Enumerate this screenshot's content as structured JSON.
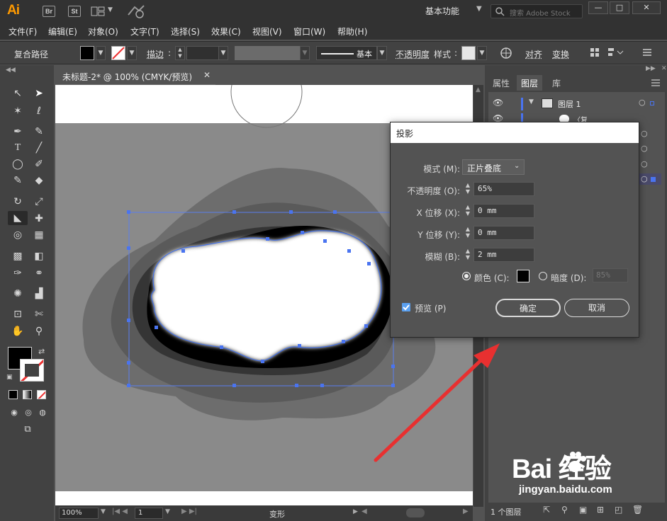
{
  "app": {
    "logo": "Ai",
    "badge_br": "Br",
    "badge_st": "St",
    "workspace": "基本功能",
    "stock_placeholder": "搜索 Adobe Stock"
  },
  "menu": [
    "文件(F)",
    "编辑(E)",
    "对象(O)",
    "文字(T)",
    "选择(S)",
    "效果(C)",
    "视图(V)",
    "窗口(W)",
    "帮助(H)"
  ],
  "control": {
    "selection_type": "复合路径",
    "stroke_label": "描边",
    "profile": "基本",
    "opacity_label": "不透明度",
    "style_label": "样式",
    "align_label": "对齐",
    "transform_label": "变换"
  },
  "document": {
    "tab_title": "未标题-2* @ 100% (CMYK/预览)",
    "zoom": "100%",
    "artboard": "1",
    "status": "变形"
  },
  "panels": {
    "tabs": [
      "属性",
      "图层",
      "库"
    ],
    "active_tab": "图层",
    "layer_name": "图层 1",
    "sublayer_name": "〈复",
    "layer_count": "1 个图层"
  },
  "dialog": {
    "title": "投影",
    "mode_label": "模式 (M):",
    "mode_value": "正片叠底",
    "opacity_label": "不透明度 (O):",
    "opacity_value": "65%",
    "x_label": "X 位移 (X):",
    "x_value": "0 mm",
    "y_label": "Y 位移 (Y):",
    "y_value": "0 mm",
    "blur_label": "模糊 (B):",
    "blur_value": "2 mm",
    "color_label": "颜色 (C):",
    "darkness_label": "暗度 (D):",
    "darkness_value": "85%",
    "preview_label": "预览 (P)",
    "ok": "确定",
    "cancel": "取消",
    "colors": {
      "accent": "#5aa0f0",
      "shadow_color": "#000000"
    }
  },
  "watermark": {
    "brand": "Bai 经验",
    "url": "jingyan.baidu.com"
  }
}
